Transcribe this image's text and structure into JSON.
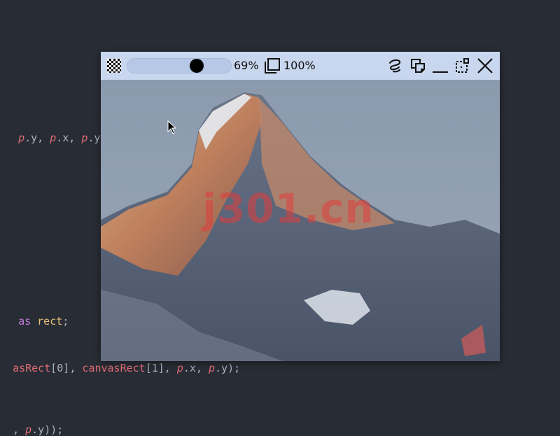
{
  "code_lines": {
    "line1": {
      "seg1": "p",
      "seg2": ".y, ",
      "seg3": "p",
      "seg4": ".x, ",
      "seg5": "p",
      "seg6": ".y);"
    },
    "line2": {
      "seg1": "as",
      "seg2": " ",
      "seg3": "rect",
      "seg4": ";"
    },
    "line3": {
      "seg1": "asRect",
      "seg2": "[0], ",
      "seg3": "canvasRect",
      "seg4": "[1], ",
      "seg5": "p",
      "seg6": ".x, ",
      "seg7": "p",
      "seg8": ".y);"
    },
    "line4": {
      "seg1": ", ",
      "seg2": "p",
      "seg3": ".y));"
    }
  },
  "pin_window": {
    "toolbar": {
      "opacity_text": "69%",
      "opacity_value": 0.69,
      "zoom_text": "100%",
      "icons": [
        "transparency-icon",
        "zoom-fit-icon",
        "draw-icon",
        "copy-icon",
        "minimize-icon",
        "crop-icon",
        "close-icon"
      ]
    },
    "image": {
      "watermark": "j301.cn"
    }
  },
  "colors": {
    "editor_background": "#282c34",
    "toolbar_background": "#c8d6ee",
    "keyword": "#c678dd",
    "identifier": "#e5c07b",
    "variable": "#e06c75"
  }
}
